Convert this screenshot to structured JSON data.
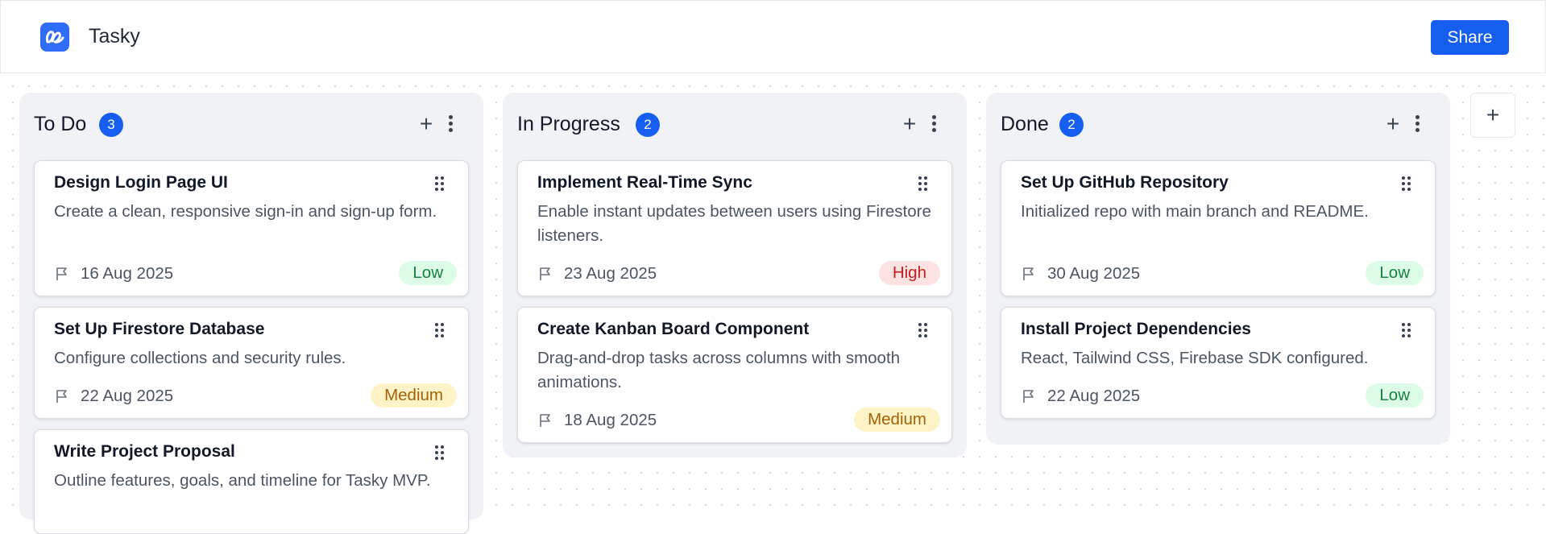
{
  "app": {
    "title": "Tasky",
    "logo_icon": "tasky-logo-icon",
    "share_label": "Share",
    "accent_color": "#155eef"
  },
  "columns": [
    {
      "title": "To Do",
      "count": "3",
      "add_label": "+",
      "cards": [
        {
          "title": "Design Login Page UI",
          "description": "Create a clean, responsive sign-in and sign-up form.",
          "date": "16 Aug 2025",
          "priority": "Low"
        },
        {
          "title": "Set Up Firestore Database",
          "description": "Configure collections and security rules.",
          "date": "22 Aug 2025",
          "priority": "Medium"
        },
        {
          "title": "Write Project Proposal",
          "description": "Outline features, goals, and timeline for Tasky MVP.",
          "date": "",
          "priority": ""
        }
      ]
    },
    {
      "title": "In Progress",
      "count": "2",
      "add_label": "+",
      "cards": [
        {
          "title": "Implement Real-Time Sync",
          "description": "Enable instant updates between users using Firestore listeners.",
          "date": "23 Aug 2025",
          "priority": "High"
        },
        {
          "title": "Create Kanban Board Component",
          "description": "Drag-and-drop tasks across columns with smooth animations.",
          "date": "18 Aug 2025",
          "priority": "Medium"
        }
      ]
    },
    {
      "title": "Done",
      "count": "2",
      "add_label": "+",
      "cards": [
        {
          "title": "Set Up GitHub Repository",
          "description": "Initialized repo with main branch and README.",
          "date": "30 Aug 2025",
          "priority": "Low"
        },
        {
          "title": "Install Project Dependencies",
          "description": "React, Tailwind CSS, Firebase SDK configured.",
          "date": "22 Aug 2025",
          "priority": "Low"
        }
      ]
    }
  ],
  "add_column_label": "+",
  "priority_colors": {
    "Low": "#15803d",
    "Medium": "#a16207",
    "High": "#c81e1e"
  }
}
